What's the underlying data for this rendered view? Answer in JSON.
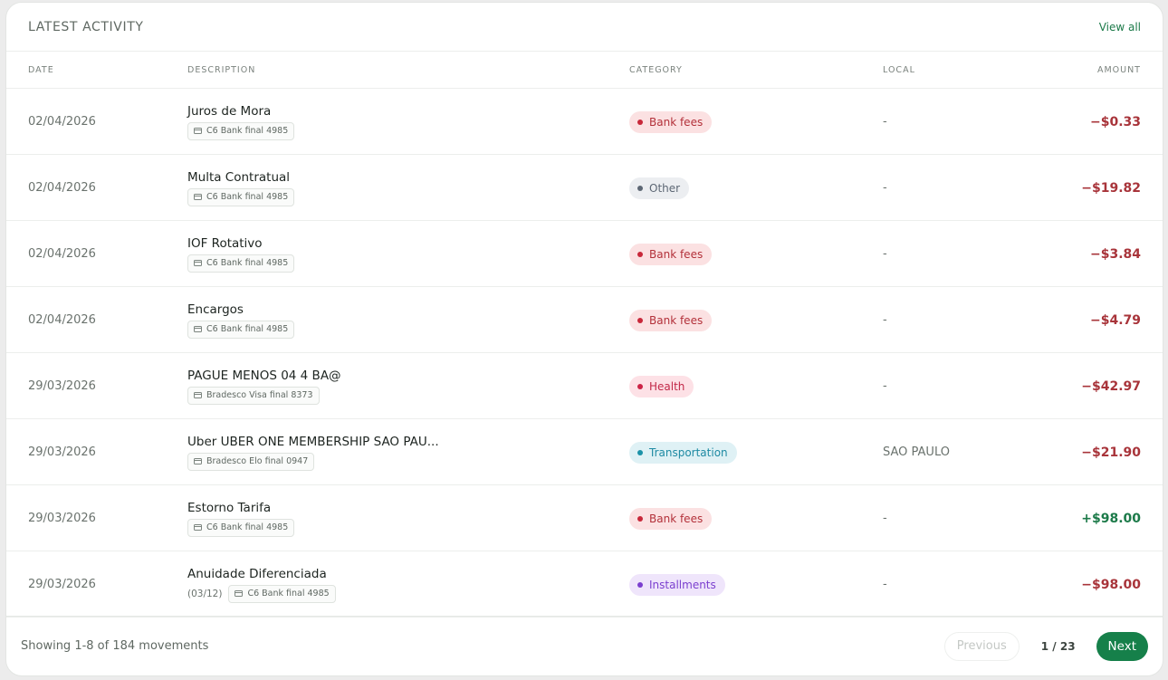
{
  "header": {
    "title": "LATEST ACTIVITY",
    "view_all": "View all"
  },
  "columns": {
    "date": "DATE",
    "description": "DESCRIPTION",
    "category": "CATEGORY",
    "local": "LOCAL",
    "amount": "AMOUNT"
  },
  "categories": {
    "bank_fees": {
      "bg": "#fbe1e2",
      "text": "#b3313a",
      "dot": "#c8283a"
    },
    "other": {
      "bg": "#eceef1",
      "text": "#5d6774",
      "dot": "#5d6774"
    },
    "health": {
      "bg": "#fde1e6",
      "text": "#c22848",
      "dot": "#cc2346"
    },
    "transportation": {
      "bg": "#dff1f5",
      "text": "#1e8aa3",
      "dot": "#1b92a8"
    },
    "installments": {
      "bg": "#efe5fb",
      "text": "#7b3fcf",
      "dot": "#7b3fcf"
    }
  },
  "rows": [
    {
      "date": "02/04/2026",
      "title": "Juros de Mora",
      "installment": "",
      "account": "C6 Bank final 4985",
      "category": "Bank fees",
      "category_key": "bank_fees",
      "local": "-",
      "amount": "−$0.33",
      "sign": "neg"
    },
    {
      "date": "02/04/2026",
      "title": "Multa Contratual",
      "installment": "",
      "account": "C6 Bank final 4985",
      "category": "Other",
      "category_key": "other",
      "local": "-",
      "amount": "−$19.82",
      "sign": "neg"
    },
    {
      "date": "02/04/2026",
      "title": "IOF Rotativo",
      "installment": "",
      "account": "C6 Bank final 4985",
      "category": "Bank fees",
      "category_key": "bank_fees",
      "local": "-",
      "amount": "−$3.84",
      "sign": "neg"
    },
    {
      "date": "02/04/2026",
      "title": "Encargos",
      "installment": "",
      "account": "C6 Bank final 4985",
      "category": "Bank fees",
      "category_key": "bank_fees",
      "local": "-",
      "amount": "−$4.79",
      "sign": "neg"
    },
    {
      "date": "29/03/2026",
      "title": "PAGUE MENOS 04 4 BA@",
      "installment": "",
      "account": "Bradesco Visa final 8373",
      "category": "Health",
      "category_key": "health",
      "local": "-",
      "amount": "−$42.97",
      "sign": "neg"
    },
    {
      "date": "29/03/2026",
      "title": "Uber UBER ONE MEMBERSHIP SAO PAU...",
      "installment": "",
      "account": "Bradesco Elo final 0947",
      "category": "Transportation",
      "category_key": "transportation",
      "local": "SAO PAULO",
      "amount": "−$21.90",
      "sign": "neg"
    },
    {
      "date": "29/03/2026",
      "title": "Estorno Tarifa",
      "installment": "",
      "account": "C6 Bank final 4985",
      "category": "Bank fees",
      "category_key": "bank_fees",
      "local": "-",
      "amount": "+$98.00",
      "sign": "pos"
    },
    {
      "date": "29/03/2026",
      "title": "Anuidade Diferenciada",
      "installment": "(03/12)",
      "account": "C6 Bank final 4985",
      "category": "Installments",
      "category_key": "installments",
      "local": "-",
      "amount": "−$98.00",
      "sign": "neg"
    }
  ],
  "footer": {
    "showing": "Showing 1-8 of 184 movements",
    "previous": "Previous",
    "page": "1 / 23",
    "next": "Next"
  }
}
